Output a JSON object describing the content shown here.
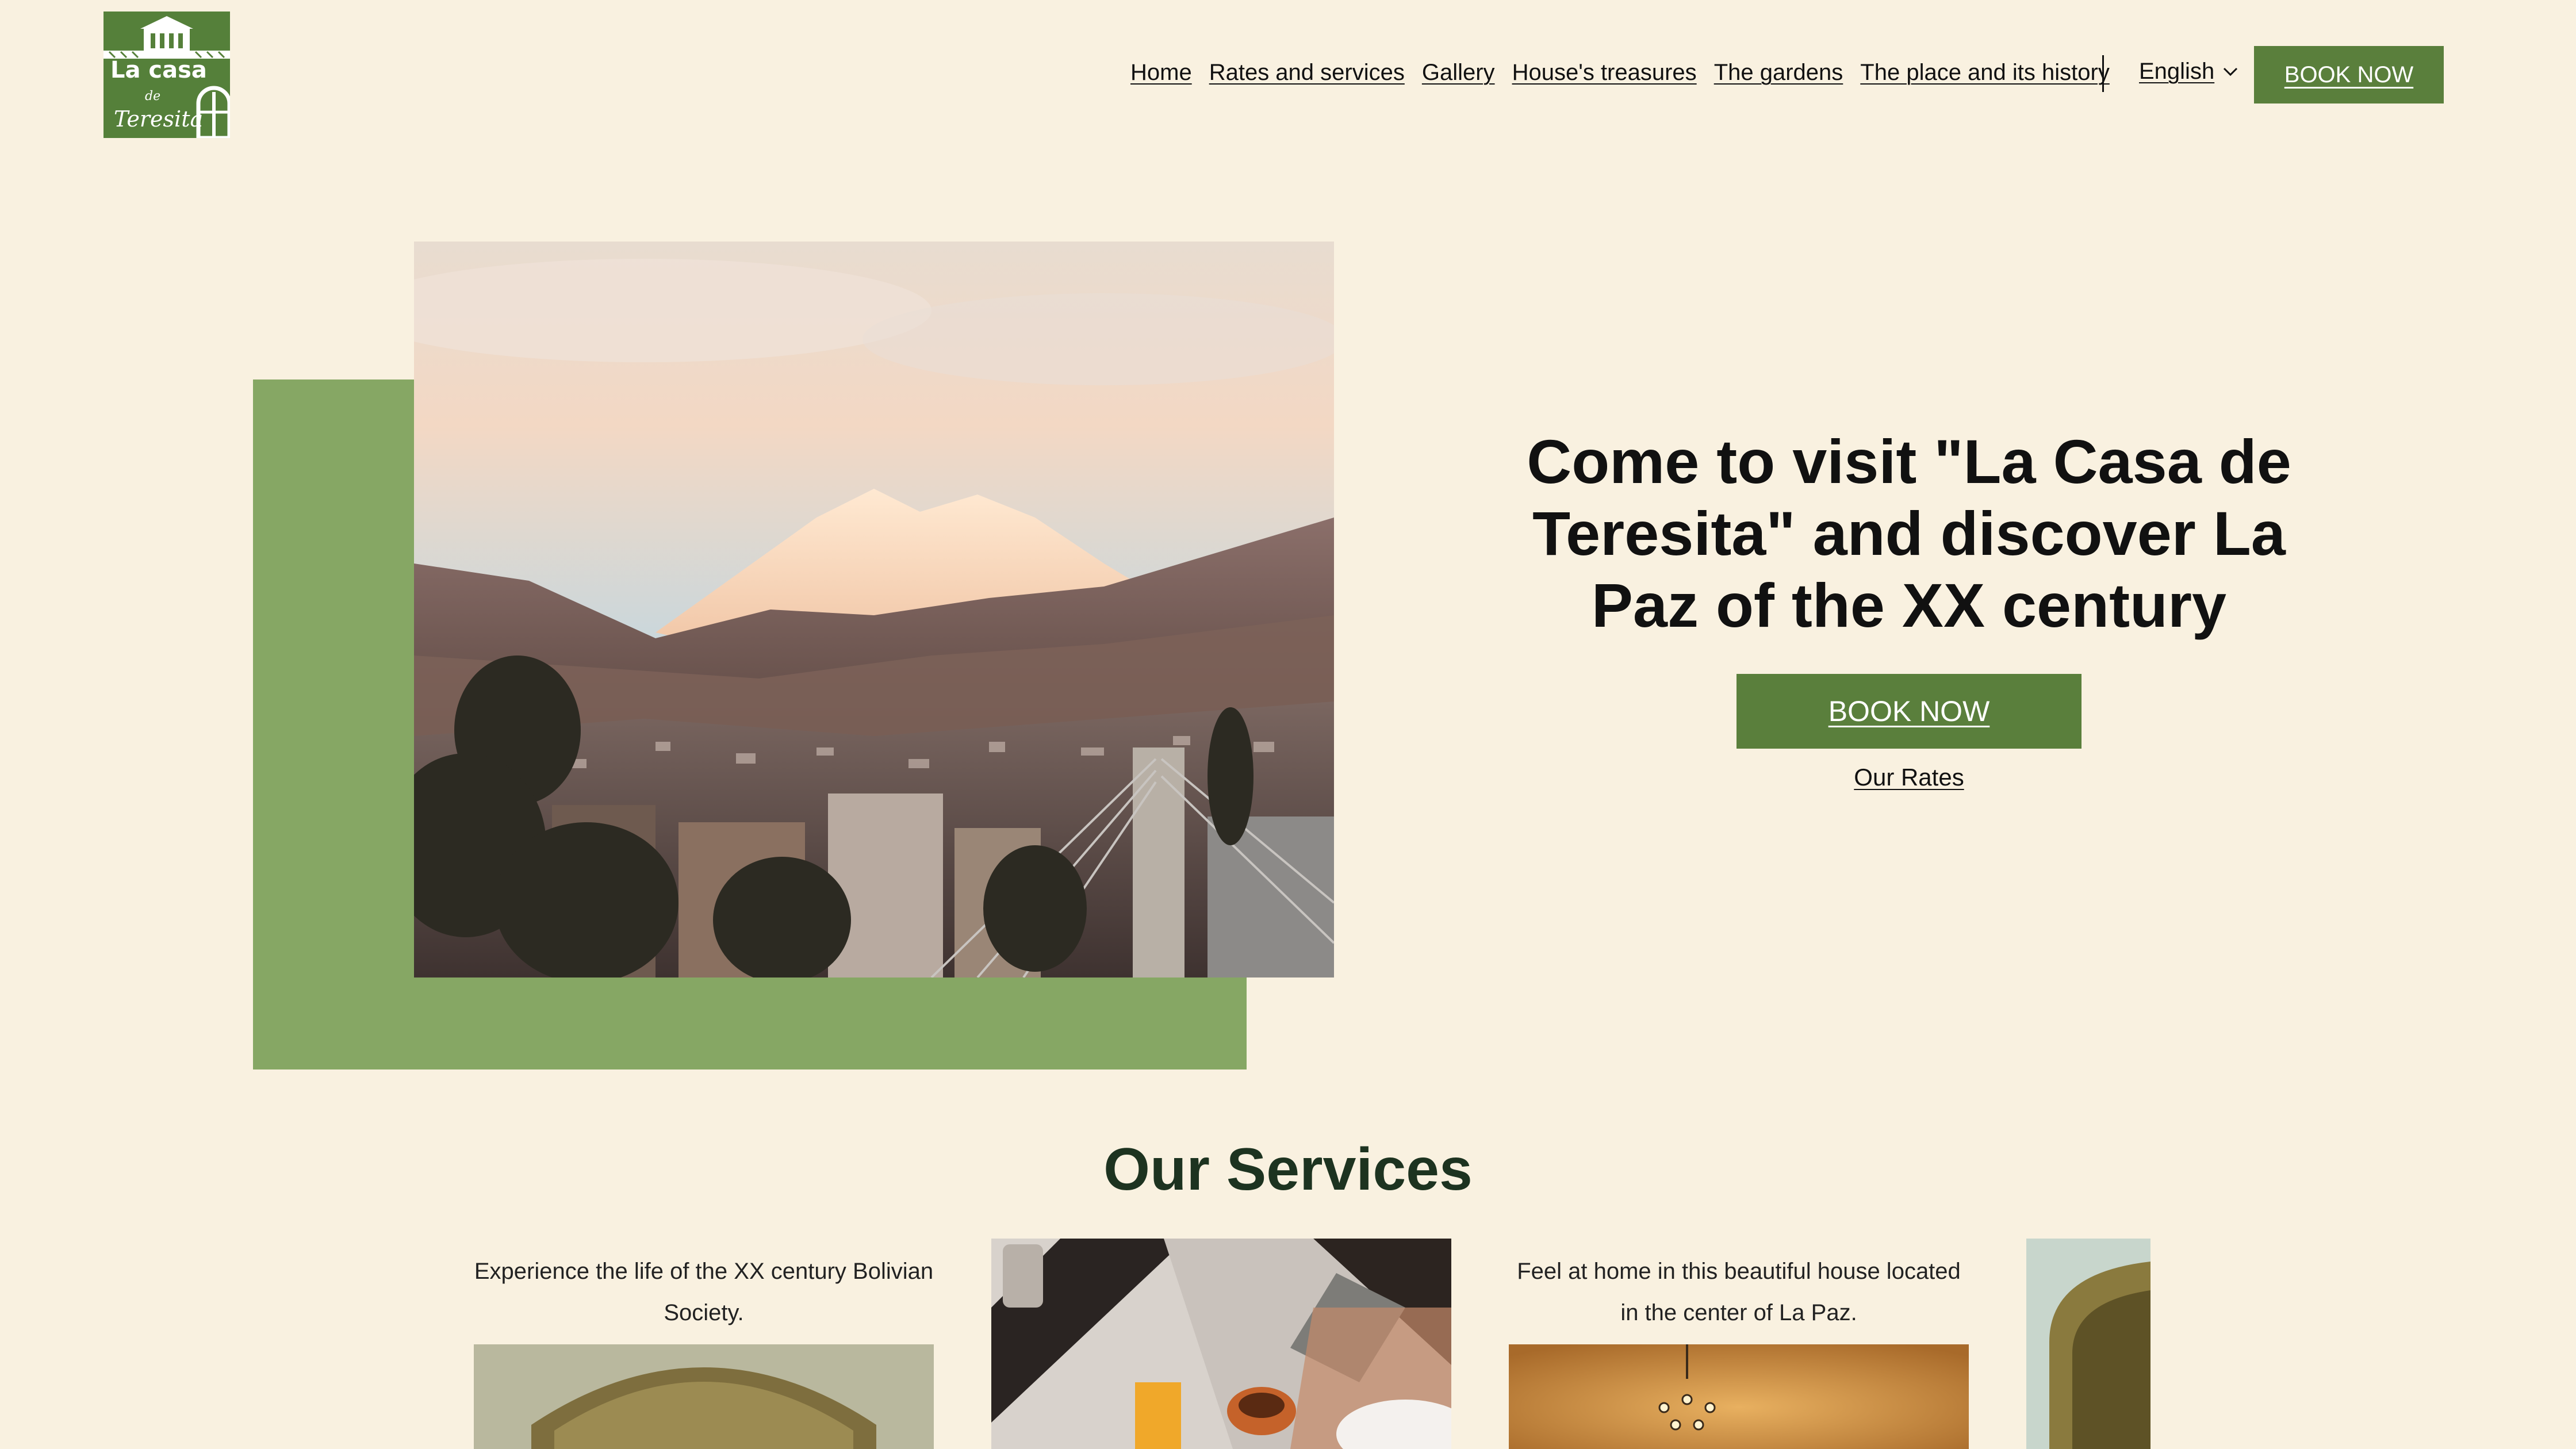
{
  "header": {
    "logo": {
      "line1": "La casa",
      "line2": "de",
      "line3": "Teresita",
      "color": "#55803a"
    },
    "nav": [
      {
        "label": "Home"
      },
      {
        "label": "Rates and services"
      },
      {
        "label": "Gallery"
      },
      {
        "label": "House's treasures"
      },
      {
        "label": "The gardens"
      },
      {
        "label": "The place and its history"
      }
    ],
    "language": {
      "selected": "English",
      "icon": "chevron-down-icon"
    },
    "book_label": "BOOK NOW"
  },
  "hero": {
    "image_alt": "Illimani mountain over La Paz",
    "title": "Come to visit \"La Casa de Teresita\" and discover La Paz of the XX century",
    "book_label": "BOOK NOW",
    "rates_label": "Our Rates",
    "accent_color": "#86a764"
  },
  "services": {
    "title": "Our Services",
    "cards": [
      {
        "text": "Experience the life of the XX century Bolivian Society."
      },
      {
        "text": ""
      },
      {
        "text": "Feel at home in this beautiful house located in the center of La Paz."
      },
      {
        "text": ""
      }
    ]
  },
  "colors": {
    "background": "#f9f1e0",
    "brand_green": "#5a7f3c",
    "heading_dark_green": "#1d3320"
  }
}
